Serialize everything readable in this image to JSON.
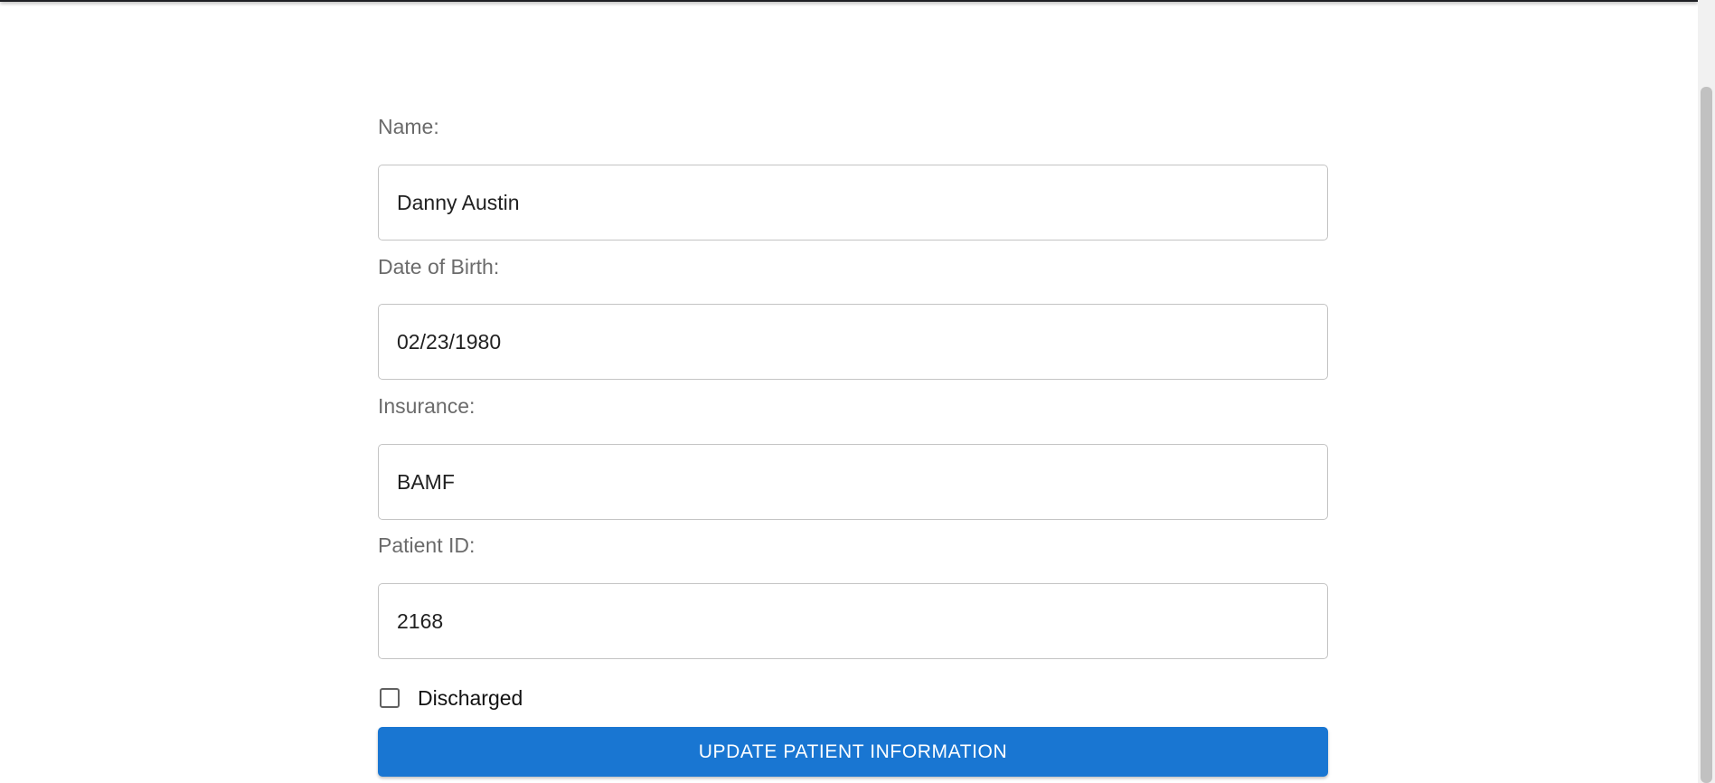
{
  "form": {
    "fields": [
      {
        "label": "Name:",
        "value": "Danny Austin"
      },
      {
        "label": "Date of Birth:",
        "value": "02/23/1980"
      },
      {
        "label": "Insurance:",
        "value": "BAMF"
      },
      {
        "label": "Patient ID:",
        "value": "2168"
      }
    ],
    "discharged": {
      "label": "Discharged",
      "checked": false
    },
    "submit_label": "UPDATE PATIENT INFORMATION"
  },
  "colors": {
    "accent": "#1976d2",
    "label": "#6b6b6b",
    "input_border": "#c4c4c4"
  }
}
